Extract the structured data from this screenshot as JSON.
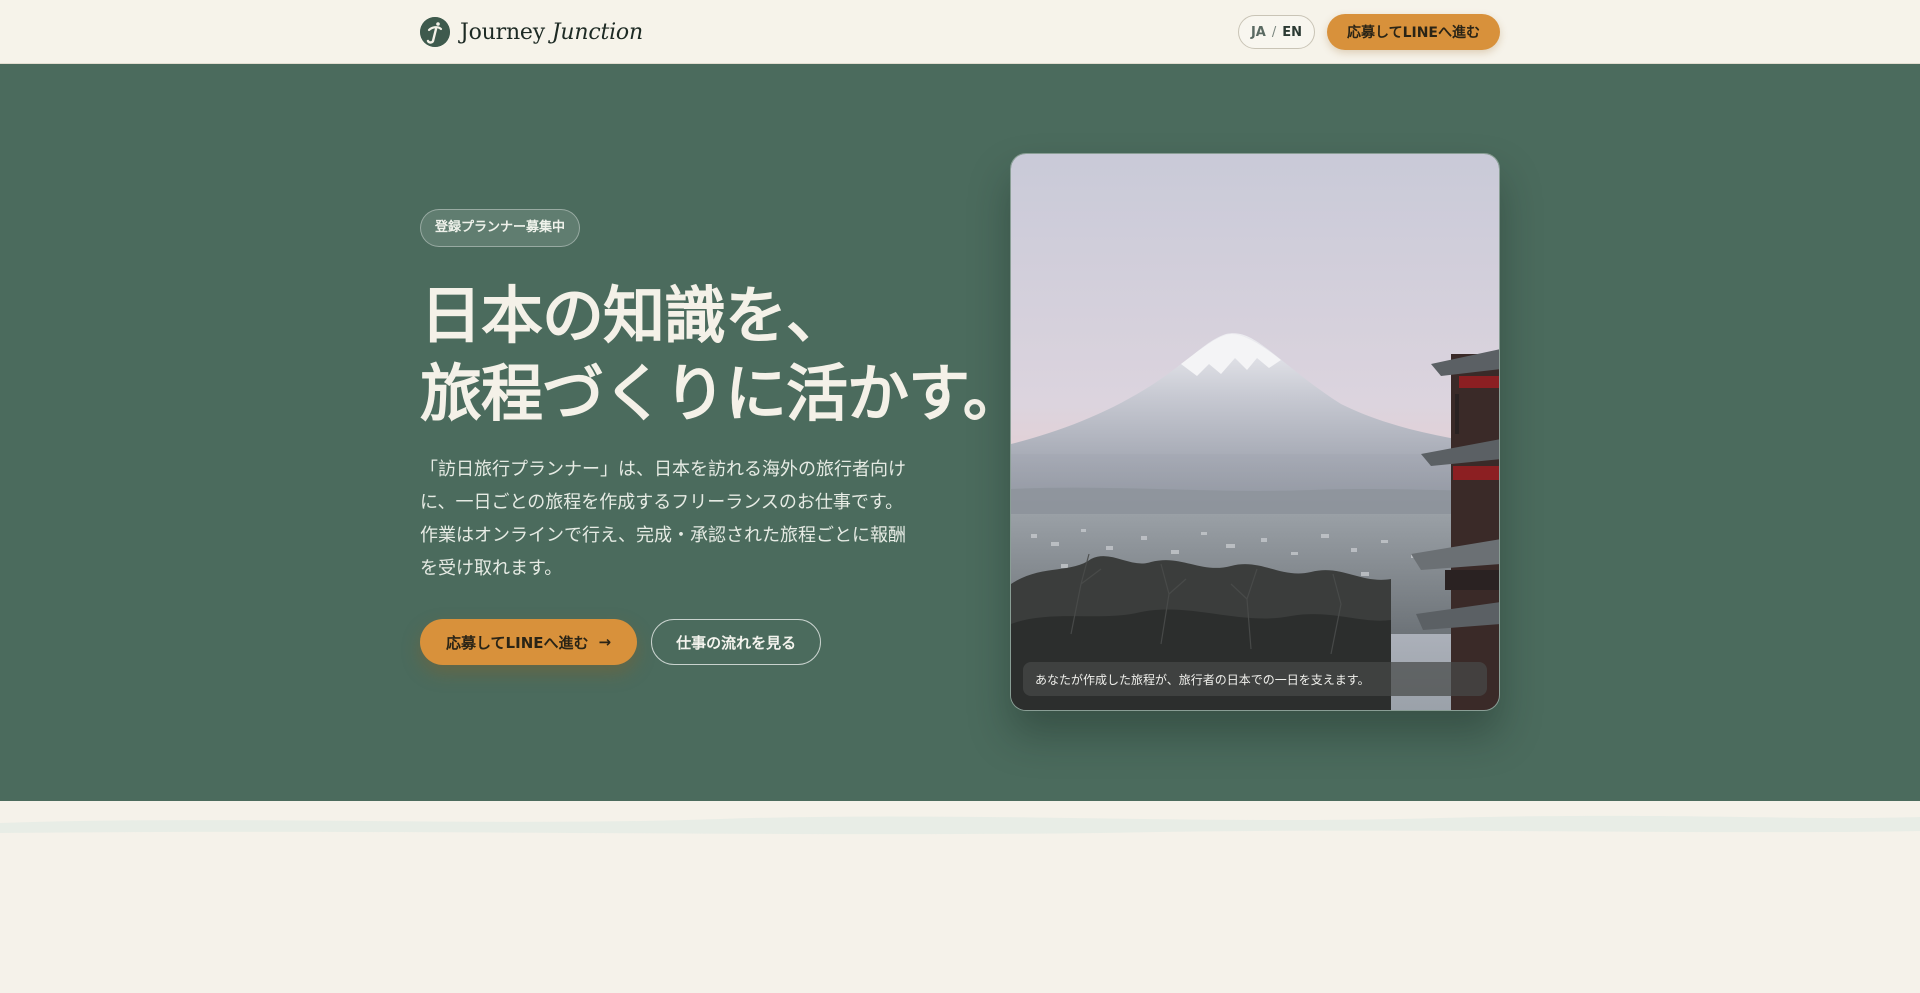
{
  "header": {
    "brand_main": "Journey",
    "brand_italic": "Junction",
    "lang_ja": "JA",
    "lang_sep": "/",
    "lang_en": "EN",
    "cta_label": "応募してLINEへ進む"
  },
  "hero": {
    "badge": "登録プランナー募集中",
    "title_line1": "日本の知識を、",
    "title_line2": "旅程づくりに活かす。",
    "description": "「訪日旅行プランナー」は、日本を訪れる海外の旅行者向けに、一日ごとの旅程を作成するフリーランスのお仕事です。作業はオンラインで行え、完成・承認された旅程ごとに報酬を受け取れます。",
    "primary_button": "応募してLINEへ進む",
    "primary_arrow": "→",
    "secondary_button": "仕事の流れを見る",
    "image_caption": "あなたが作成した旅程が、旅行者の日本での一日を支えます。"
  },
  "colors": {
    "hero_bg": "#4b6b5d",
    "accent": "#d8913b",
    "page_bg": "#f5f2ea"
  },
  "icons": {
    "brand": "journey-junction-logo-icon",
    "arrow": "arrow-right-icon"
  }
}
